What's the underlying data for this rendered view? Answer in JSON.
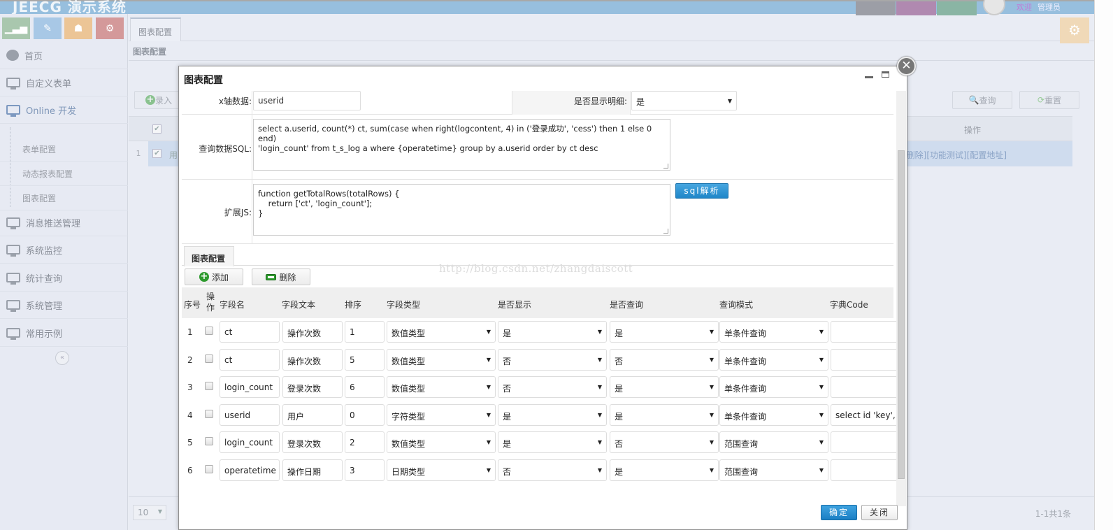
{
  "app": {
    "brand": "JEECG 演示系统",
    "welcome": "欢迎",
    "username": "管理员"
  },
  "sidebar": {
    "shortcuts": [
      "chart-icon",
      "pencil-icon",
      "users-icon",
      "cogs-icon"
    ],
    "items": [
      {
        "label": "首页",
        "icon": "dashboard-icon"
      },
      {
        "label": "自定义表单",
        "icon": "monitor-icon"
      },
      {
        "label": "Online 开发",
        "icon": "monitor-icon"
      },
      {
        "label": "消息推送管理",
        "icon": "monitor-icon"
      },
      {
        "label": "系统监控",
        "icon": "monitor-icon"
      },
      {
        "label": "统计查询",
        "icon": "monitor-icon"
      },
      {
        "label": "系统管理",
        "icon": "monitor-icon"
      },
      {
        "label": "常用示例",
        "icon": "monitor-icon"
      }
    ],
    "subitems": [
      "表单配置",
      "动态报表配置",
      "图表配置"
    ],
    "collapse": "«"
  },
  "main": {
    "tab": "图表配置",
    "breadcrumb": "图表配置",
    "add_button": "录入",
    "search_button": "查询",
    "reset_button": "重置",
    "grid_header_op": "操作",
    "grid_row": {
      "num": "1",
      "first_char": "用",
      "links": "[删除][功能测试][配置地址]"
    },
    "pager": {
      "page_size": "10",
      "info": "1-1共1条"
    }
  },
  "dialog": {
    "title": "图表配置",
    "form": {
      "xaxis_label": "x轴数据:",
      "xaxis_value": "userid",
      "show_detail_label": "是否显示明细:",
      "show_detail_value": "是",
      "sql_label": "查询数据SQL:",
      "sql_value": "select a.userid, count(*) ct, sum(case when right(logcontent, 4) in ('登录成功', 'cess') then 1 else 0 end)\n'login_count' from t_s_log a where {operatetime} group by a.userid order by ct desc",
      "sql_button": "sql解析",
      "js_label": "扩展JS:",
      "js_value": "function getTotalRows(totalRows) {\n    return ['ct', 'login_count'];\n}"
    },
    "subtab": "图表配置",
    "add_label": "添加",
    "delete_label": "删除",
    "watermark": "http://blog.csdn.net/zhangdaiscott",
    "columns": [
      "序号",
      "操作",
      "字段名",
      "字段文本",
      "排序",
      "字段类型",
      "是否显示",
      "是否查询",
      "查询模式",
      "字典Code"
    ],
    "rows": [
      {
        "num": "1",
        "field": "ct",
        "text": "操作次数",
        "order": "1",
        "type": "数值类型",
        "show": "是",
        "query": "是",
        "mode": "单条件查询",
        "dict": ""
      },
      {
        "num": "2",
        "field": "ct",
        "text": "操作次数",
        "order": "5",
        "type": "数值类型",
        "show": "否",
        "query": "否",
        "mode": "单条件查询",
        "dict": ""
      },
      {
        "num": "3",
        "field": "login_count",
        "text": "登录次数",
        "order": "6",
        "type": "数值类型",
        "show": "否",
        "query": "是",
        "mode": "单条件查询",
        "dict": ""
      },
      {
        "num": "4",
        "field": "userid",
        "text": "用户",
        "order": "0",
        "type": "字符类型",
        "show": "是",
        "query": "是",
        "mode": "单条件查询",
        "dict": "select id 'key', r"
      },
      {
        "num": "5",
        "field": "login_count",
        "text": "登录次数",
        "order": "2",
        "type": "数值类型",
        "show": "是",
        "query": "否",
        "mode": "范围查询",
        "dict": ""
      },
      {
        "num": "6",
        "field": "operatetime",
        "text": "操作日期",
        "order": "3",
        "type": "日期类型",
        "show": "否",
        "query": "是",
        "mode": "范围查询",
        "dict": ""
      }
    ],
    "ok_button": "确定",
    "close_button": "关闭"
  }
}
